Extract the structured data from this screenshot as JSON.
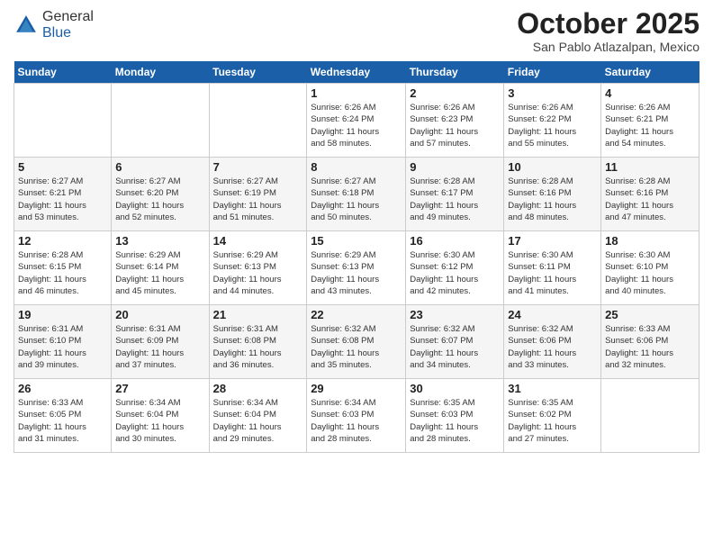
{
  "logo": {
    "general": "General",
    "blue": "Blue"
  },
  "header": {
    "month": "October 2025",
    "location": "San Pablo Atlazalpan, Mexico"
  },
  "days_of_week": [
    "Sunday",
    "Monday",
    "Tuesday",
    "Wednesday",
    "Thursday",
    "Friday",
    "Saturday"
  ],
  "weeks": [
    [
      {
        "day": "",
        "info": ""
      },
      {
        "day": "",
        "info": ""
      },
      {
        "day": "",
        "info": ""
      },
      {
        "day": "1",
        "info": "Sunrise: 6:26 AM\nSunset: 6:24 PM\nDaylight: 11 hours\nand 58 minutes."
      },
      {
        "day": "2",
        "info": "Sunrise: 6:26 AM\nSunset: 6:23 PM\nDaylight: 11 hours\nand 57 minutes."
      },
      {
        "day": "3",
        "info": "Sunrise: 6:26 AM\nSunset: 6:22 PM\nDaylight: 11 hours\nand 55 minutes."
      },
      {
        "day": "4",
        "info": "Sunrise: 6:26 AM\nSunset: 6:21 PM\nDaylight: 11 hours\nand 54 minutes."
      }
    ],
    [
      {
        "day": "5",
        "info": "Sunrise: 6:27 AM\nSunset: 6:21 PM\nDaylight: 11 hours\nand 53 minutes."
      },
      {
        "day": "6",
        "info": "Sunrise: 6:27 AM\nSunset: 6:20 PM\nDaylight: 11 hours\nand 52 minutes."
      },
      {
        "day": "7",
        "info": "Sunrise: 6:27 AM\nSunset: 6:19 PM\nDaylight: 11 hours\nand 51 minutes."
      },
      {
        "day": "8",
        "info": "Sunrise: 6:27 AM\nSunset: 6:18 PM\nDaylight: 11 hours\nand 50 minutes."
      },
      {
        "day": "9",
        "info": "Sunrise: 6:28 AM\nSunset: 6:17 PM\nDaylight: 11 hours\nand 49 minutes."
      },
      {
        "day": "10",
        "info": "Sunrise: 6:28 AM\nSunset: 6:16 PM\nDaylight: 11 hours\nand 48 minutes."
      },
      {
        "day": "11",
        "info": "Sunrise: 6:28 AM\nSunset: 6:16 PM\nDaylight: 11 hours\nand 47 minutes."
      }
    ],
    [
      {
        "day": "12",
        "info": "Sunrise: 6:28 AM\nSunset: 6:15 PM\nDaylight: 11 hours\nand 46 minutes."
      },
      {
        "day": "13",
        "info": "Sunrise: 6:29 AM\nSunset: 6:14 PM\nDaylight: 11 hours\nand 45 minutes."
      },
      {
        "day": "14",
        "info": "Sunrise: 6:29 AM\nSunset: 6:13 PM\nDaylight: 11 hours\nand 44 minutes."
      },
      {
        "day": "15",
        "info": "Sunrise: 6:29 AM\nSunset: 6:13 PM\nDaylight: 11 hours\nand 43 minutes."
      },
      {
        "day": "16",
        "info": "Sunrise: 6:30 AM\nSunset: 6:12 PM\nDaylight: 11 hours\nand 42 minutes."
      },
      {
        "day": "17",
        "info": "Sunrise: 6:30 AM\nSunset: 6:11 PM\nDaylight: 11 hours\nand 41 minutes."
      },
      {
        "day": "18",
        "info": "Sunrise: 6:30 AM\nSunset: 6:10 PM\nDaylight: 11 hours\nand 40 minutes."
      }
    ],
    [
      {
        "day": "19",
        "info": "Sunrise: 6:31 AM\nSunset: 6:10 PM\nDaylight: 11 hours\nand 39 minutes."
      },
      {
        "day": "20",
        "info": "Sunrise: 6:31 AM\nSunset: 6:09 PM\nDaylight: 11 hours\nand 37 minutes."
      },
      {
        "day": "21",
        "info": "Sunrise: 6:31 AM\nSunset: 6:08 PM\nDaylight: 11 hours\nand 36 minutes."
      },
      {
        "day": "22",
        "info": "Sunrise: 6:32 AM\nSunset: 6:08 PM\nDaylight: 11 hours\nand 35 minutes."
      },
      {
        "day": "23",
        "info": "Sunrise: 6:32 AM\nSunset: 6:07 PM\nDaylight: 11 hours\nand 34 minutes."
      },
      {
        "day": "24",
        "info": "Sunrise: 6:32 AM\nSunset: 6:06 PM\nDaylight: 11 hours\nand 33 minutes."
      },
      {
        "day": "25",
        "info": "Sunrise: 6:33 AM\nSunset: 6:06 PM\nDaylight: 11 hours\nand 32 minutes."
      }
    ],
    [
      {
        "day": "26",
        "info": "Sunrise: 6:33 AM\nSunset: 6:05 PM\nDaylight: 11 hours\nand 31 minutes."
      },
      {
        "day": "27",
        "info": "Sunrise: 6:34 AM\nSunset: 6:04 PM\nDaylight: 11 hours\nand 30 minutes."
      },
      {
        "day": "28",
        "info": "Sunrise: 6:34 AM\nSunset: 6:04 PM\nDaylight: 11 hours\nand 29 minutes."
      },
      {
        "day": "29",
        "info": "Sunrise: 6:34 AM\nSunset: 6:03 PM\nDaylight: 11 hours\nand 28 minutes."
      },
      {
        "day": "30",
        "info": "Sunrise: 6:35 AM\nSunset: 6:03 PM\nDaylight: 11 hours\nand 28 minutes."
      },
      {
        "day": "31",
        "info": "Sunrise: 6:35 AM\nSunset: 6:02 PM\nDaylight: 11 hours\nand 27 minutes."
      },
      {
        "day": "",
        "info": ""
      }
    ]
  ]
}
